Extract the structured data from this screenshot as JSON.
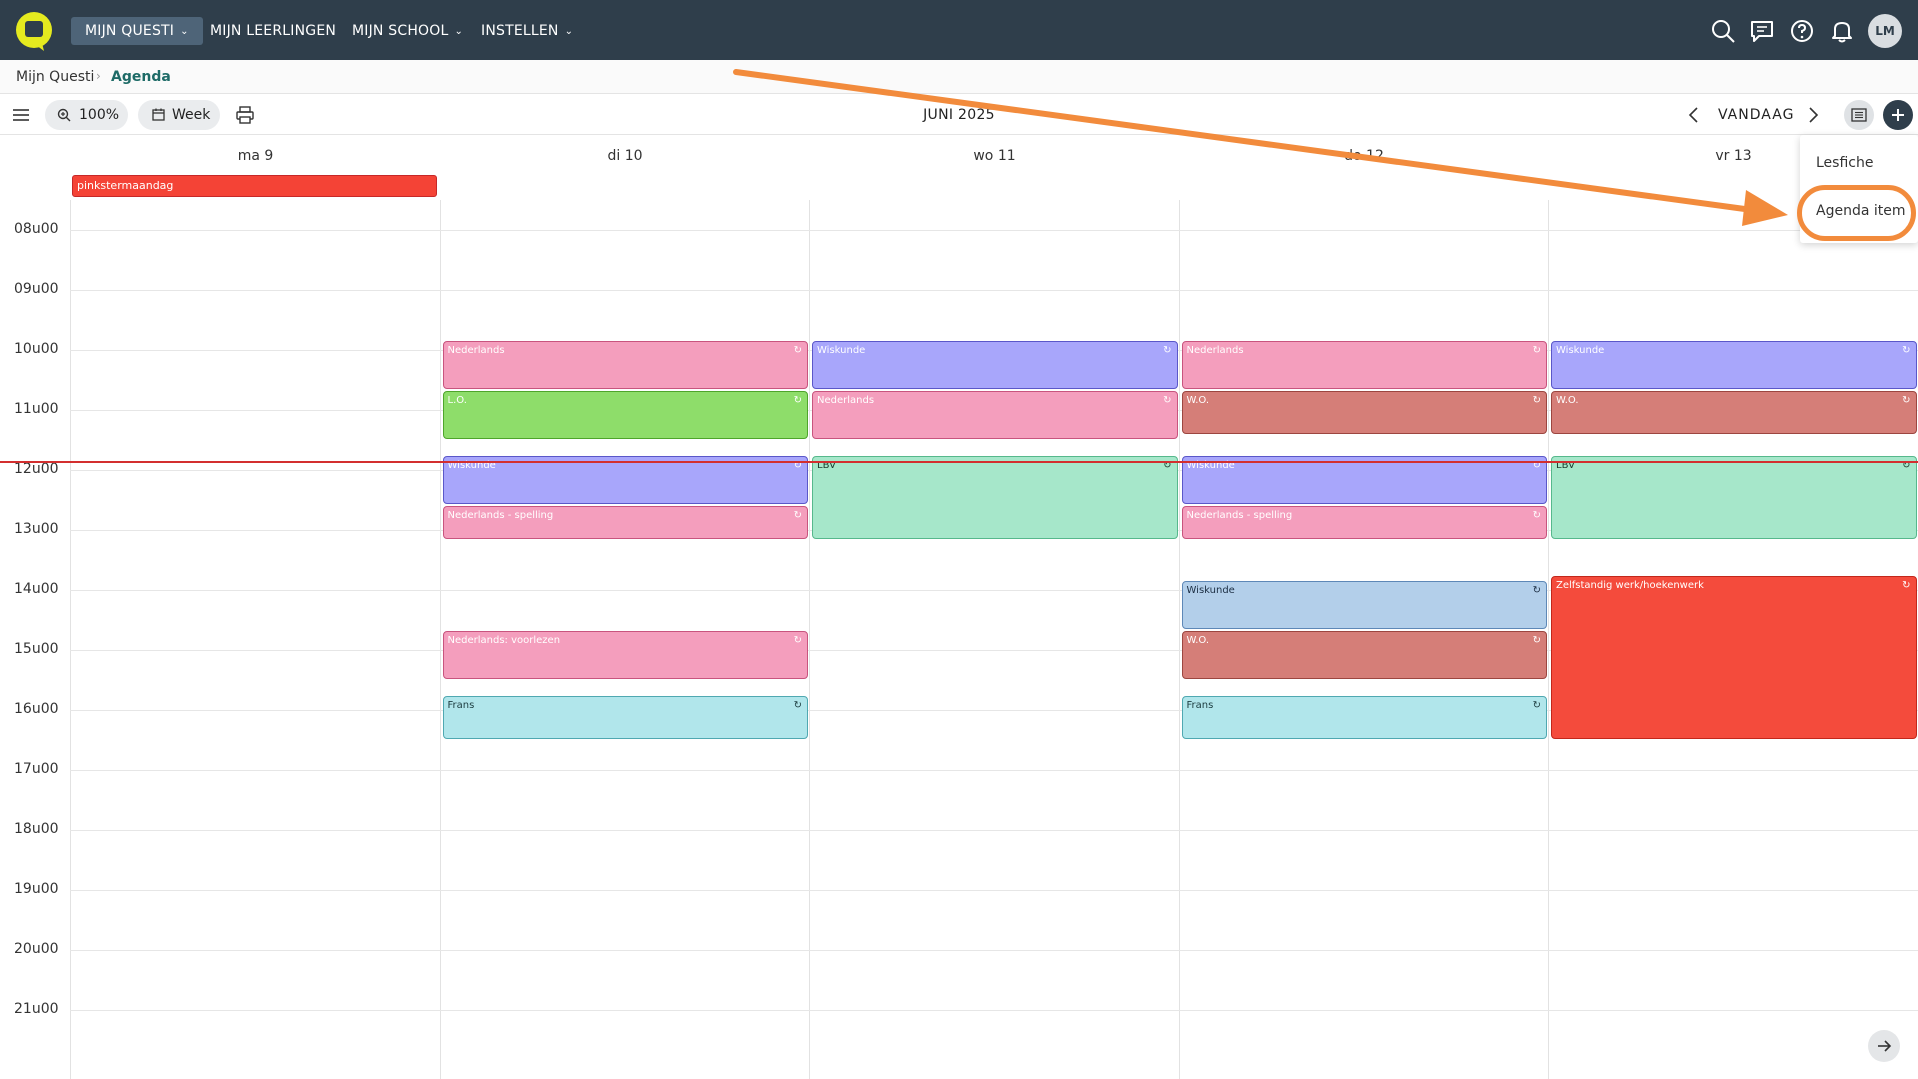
{
  "nav": {
    "items": [
      {
        "label": "MIJN QUESTI",
        "has_dropdown": true,
        "active": true
      },
      {
        "label": "MIJN LEERLINGEN",
        "has_dropdown": false,
        "active": false
      },
      {
        "label": "MIJN SCHOOL",
        "has_dropdown": true,
        "active": false
      },
      {
        "label": "INSTELLEN",
        "has_dropdown": true,
        "active": false
      }
    ],
    "avatar_initials": "LM",
    "icons": [
      "search-icon",
      "chat-icon",
      "help-icon",
      "bell-icon"
    ]
  },
  "breadcrumb": {
    "root": "Mijn Questi",
    "separator": "›",
    "current": "Agenda"
  },
  "toolbar": {
    "zoom_label": "100%",
    "view_label": "Week",
    "month_label": "JUNI 2025",
    "today_label": "VANDAAG"
  },
  "add_menu": {
    "items": [
      "Lesfiche",
      "Agenda item"
    ]
  },
  "days": [
    {
      "label": "ma 9"
    },
    {
      "label": "di 10"
    },
    {
      "label": "wo 11"
    },
    {
      "label": "do 12"
    },
    {
      "label": "vr 13"
    }
  ],
  "all_day_events": [
    {
      "day": 0,
      "title": "pinkstermaandag"
    }
  ],
  "hours": [
    "08u00",
    "09u00",
    "10u00",
    "11u00",
    "12u00",
    "13u00",
    "14u00",
    "15u00",
    "16u00",
    "17u00",
    "18u00",
    "19u00",
    "20u00",
    "21u00"
  ],
  "events": [
    {
      "day": 1,
      "start": "09:50",
      "end": "10:40",
      "title": "Nederlands",
      "color": "pink",
      "repeat": true
    },
    {
      "day": 1,
      "start": "10:40",
      "end": "11:30",
      "title": "L.O.",
      "color": "green",
      "repeat": true
    },
    {
      "day": 1,
      "start": "11:45",
      "end": "12:35",
      "title": "Wiskunde",
      "color": "purple",
      "repeat": true
    },
    {
      "day": 1,
      "start": "12:35",
      "end": "13:10",
      "title": "Nederlands - spelling",
      "color": "pink",
      "repeat": true
    },
    {
      "day": 1,
      "start": "14:40",
      "end": "15:30",
      "title": "Nederlands: voorlezen",
      "color": "pink",
      "repeat": true
    },
    {
      "day": 1,
      "start": "15:45",
      "end": "16:30",
      "title": "Frans",
      "color": "cyan",
      "repeat": true
    },
    {
      "day": 2,
      "start": "09:50",
      "end": "10:40",
      "title": "Wiskunde",
      "color": "purple",
      "repeat": true
    },
    {
      "day": 2,
      "start": "10:40",
      "end": "11:30",
      "title": "Nederlands",
      "color": "pink",
      "repeat": true
    },
    {
      "day": 2,
      "start": "11:45",
      "end": "13:10",
      "title": "LBV",
      "color": "mint",
      "repeat": true
    },
    {
      "day": 3,
      "start": "09:50",
      "end": "10:40",
      "title": "Nederlands",
      "color": "pink",
      "repeat": true
    },
    {
      "day": 3,
      "start": "10:40",
      "end": "11:25",
      "title": "W.O.",
      "color": "brown",
      "repeat": true
    },
    {
      "day": 3,
      "start": "11:45",
      "end": "12:35",
      "title": "Wiskunde",
      "color": "purple",
      "repeat": true
    },
    {
      "day": 3,
      "start": "12:35",
      "end": "13:10",
      "title": "Nederlands - spelling",
      "color": "pink",
      "repeat": true
    },
    {
      "day": 3,
      "start": "13:50",
      "end": "14:40",
      "title": "Wiskunde",
      "color": "blue",
      "repeat": true
    },
    {
      "day": 3,
      "start": "14:40",
      "end": "15:30",
      "title": "W.O.",
      "color": "brown",
      "repeat": true
    },
    {
      "day": 3,
      "start": "15:45",
      "end": "16:30",
      "title": "Frans",
      "color": "cyan",
      "repeat": true
    },
    {
      "day": 4,
      "start": "09:50",
      "end": "10:40",
      "title": "Wiskunde",
      "color": "purple",
      "repeat": true
    },
    {
      "day": 4,
      "start": "10:40",
      "end": "11:25",
      "title": "W.O.",
      "color": "brown",
      "repeat": true
    },
    {
      "day": 4,
      "start": "11:45",
      "end": "13:10",
      "title": "LBV",
      "color": "mint",
      "repeat": true
    },
    {
      "day": 4,
      "start": "13:45",
      "end": "16:30",
      "title": "Zelfstandig werk/hoekenwerk",
      "color": "red",
      "repeat": true
    }
  ],
  "colors": {
    "brand": "#e5ea1f",
    "topbar": "#2f3e4b",
    "annotation": "#f28b3c",
    "now_line": "#d32f2f"
  }
}
